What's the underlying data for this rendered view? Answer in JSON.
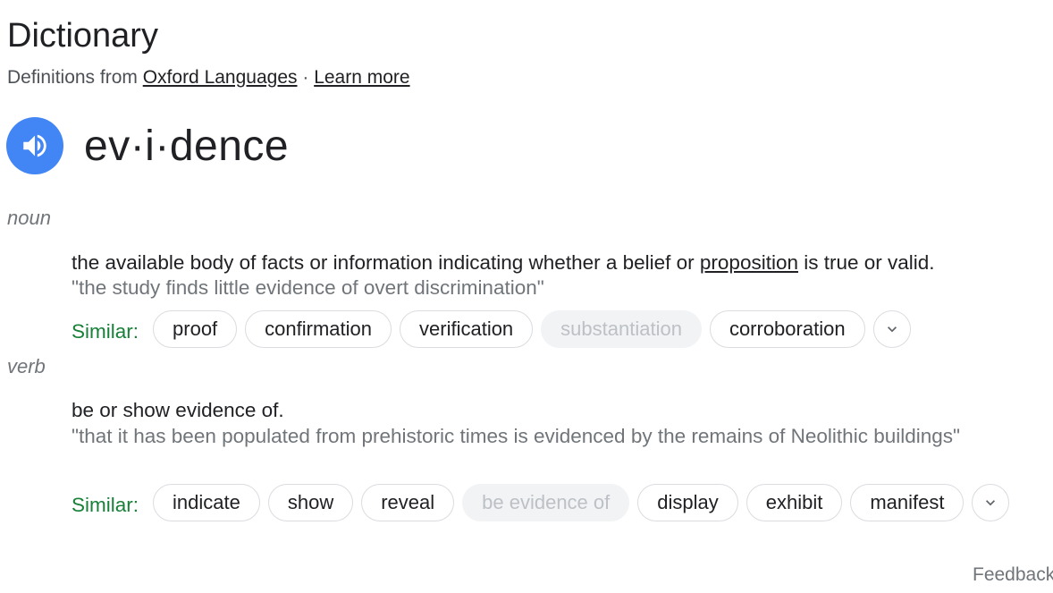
{
  "header": {
    "title": "Dictionary",
    "source_prefix": "Definitions from ",
    "source_link": "Oxford Languages",
    "separator": " · ",
    "learn_more": "Learn more"
  },
  "entry": {
    "headword": "ev·i·dence",
    "speaker_icon": "volume-icon",
    "accent_color": "#4285f4"
  },
  "senses": [
    {
      "pos": "noun",
      "definition_before": "the available body of facts or information indicating whether a belief or ",
      "definition_link": "proposition",
      "definition_after": " is true or valid.",
      "example": "\"the study finds little evidence of overt discrimination\"",
      "similar_label": "Similar:",
      "chips": [
        "proof",
        "confirmation",
        "verification",
        "substantiation",
        "corroboration"
      ],
      "disabled_chip": "substantiation"
    },
    {
      "pos": "verb",
      "definition": "be or show evidence of.",
      "example": "\"that it has been populated from prehistoric times is evidenced by the remains of Neolithic buildings\"",
      "similar_label": "Similar:",
      "chips": [
        "indicate",
        "show",
        "reveal",
        "be evidence of",
        "display",
        "exhibit",
        "manifest"
      ],
      "disabled_chip": "be evidence of"
    }
  ],
  "footer": {
    "feedback": "Feedback"
  },
  "colors": {
    "similar_green": "#188038",
    "muted_gray": "#70757a"
  }
}
